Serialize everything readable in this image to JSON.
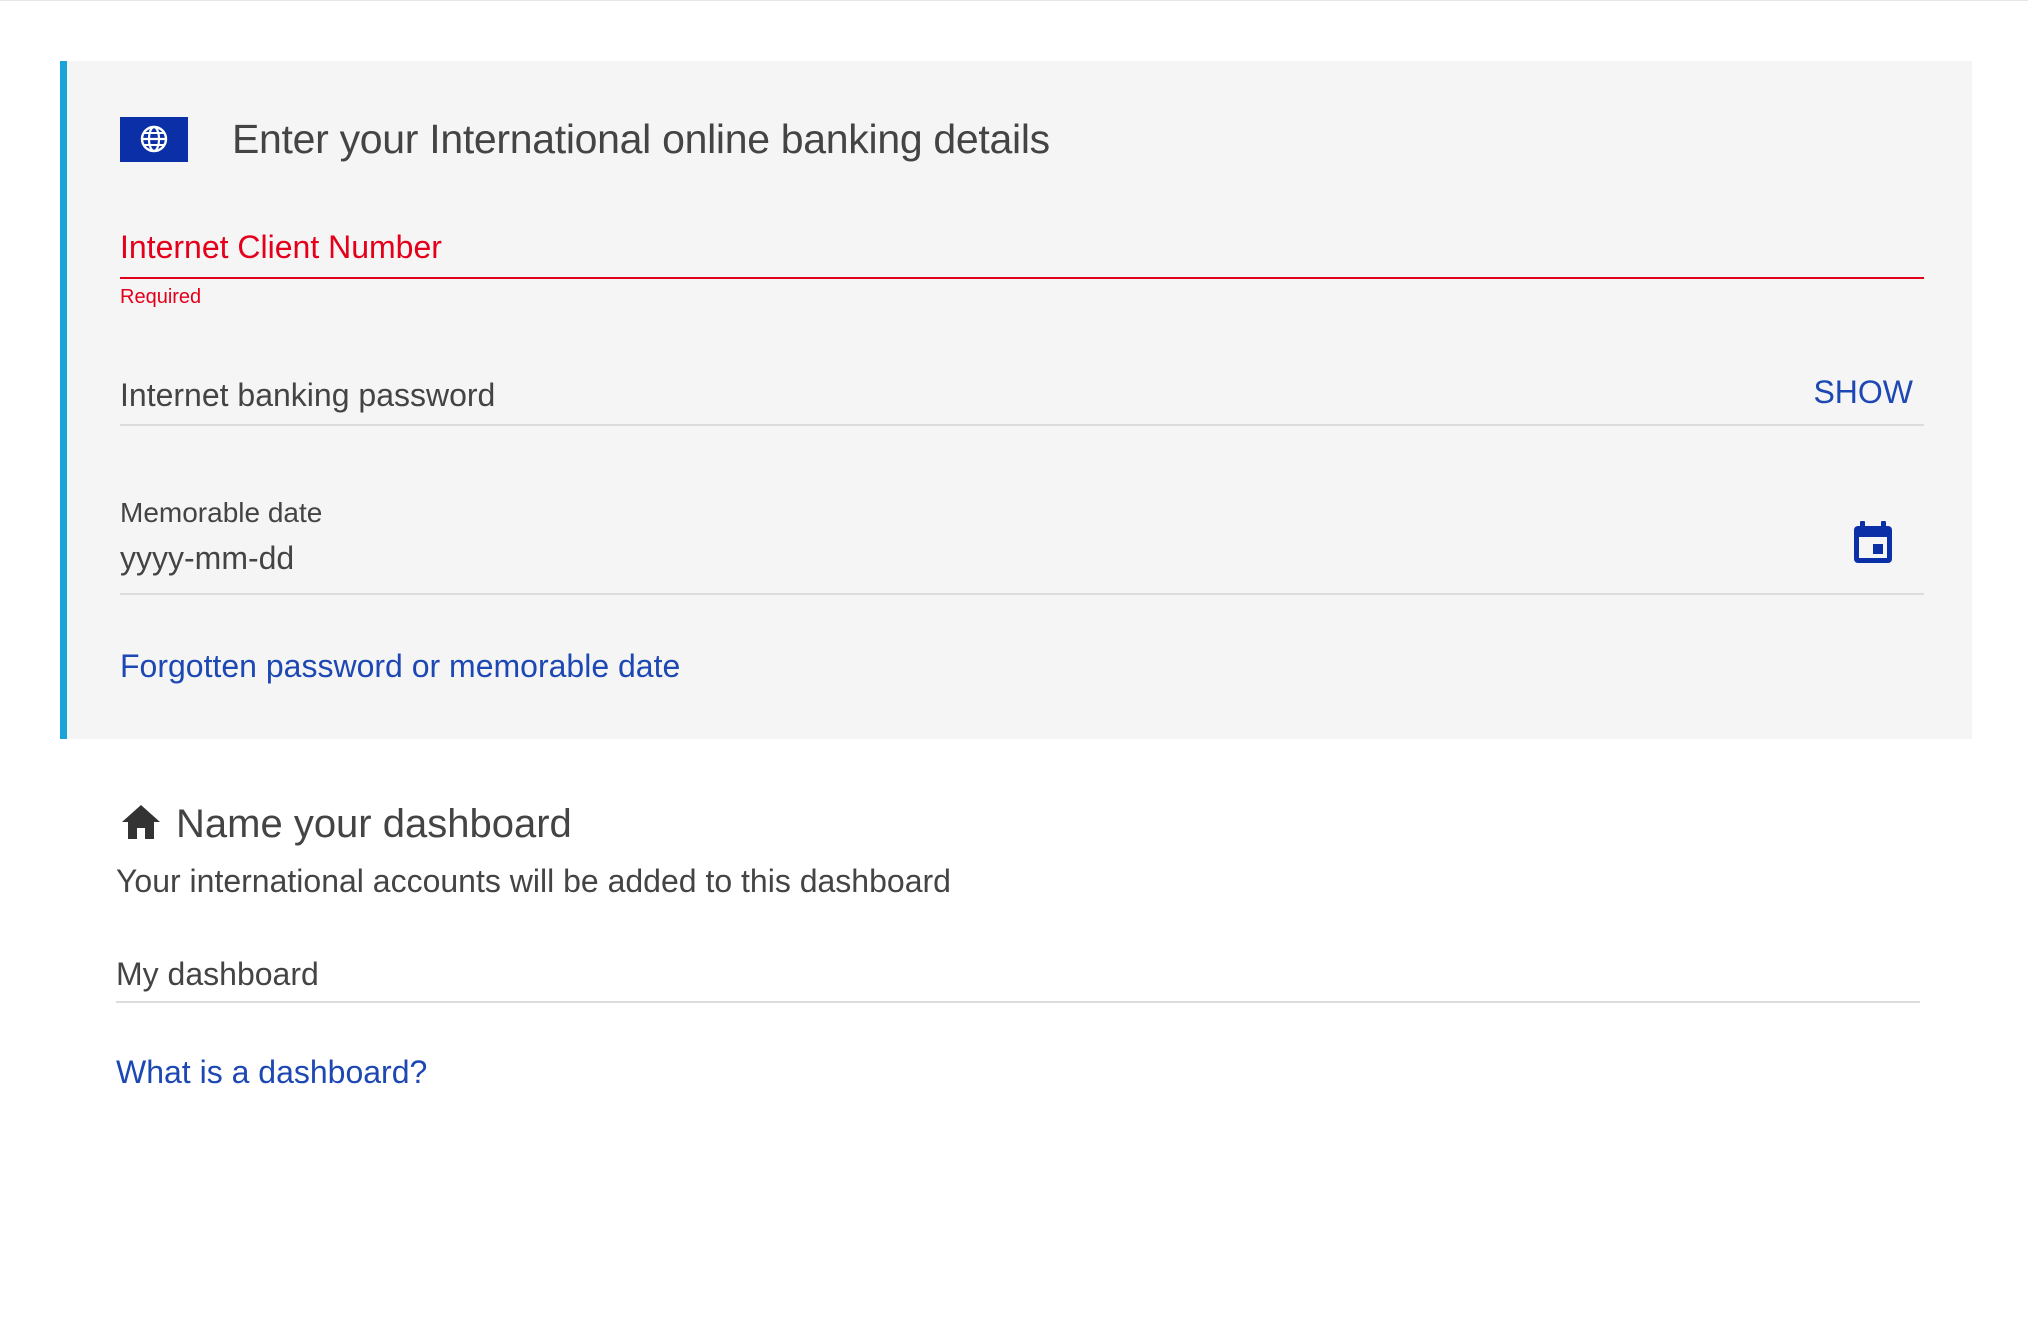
{
  "banking_panel": {
    "title": "Enter your International online banking details",
    "globe_icon": "globe-icon",
    "client_number": {
      "label": "Internet Client Number",
      "error": "Required"
    },
    "password": {
      "placeholder": "Internet banking password",
      "toggle_label": "SHOW"
    },
    "memorable_date": {
      "label": "Memorable date",
      "placeholder": "yyyy-mm-dd",
      "icon": "calendar-icon"
    },
    "forgotten_link": "Forgotten password or memorable date"
  },
  "dashboard": {
    "icon": "home-icon",
    "title": "Name your dashboard",
    "description": "Your international accounts will be added to this dashboard",
    "name_value": "My dashboard",
    "help_link": "What is a dashboard?"
  },
  "colors": {
    "accent_bar": "#1aa3d9",
    "badge_blue": "#0b2fa6",
    "error_red": "#e4001b",
    "link_blue": "#1d48b3"
  }
}
